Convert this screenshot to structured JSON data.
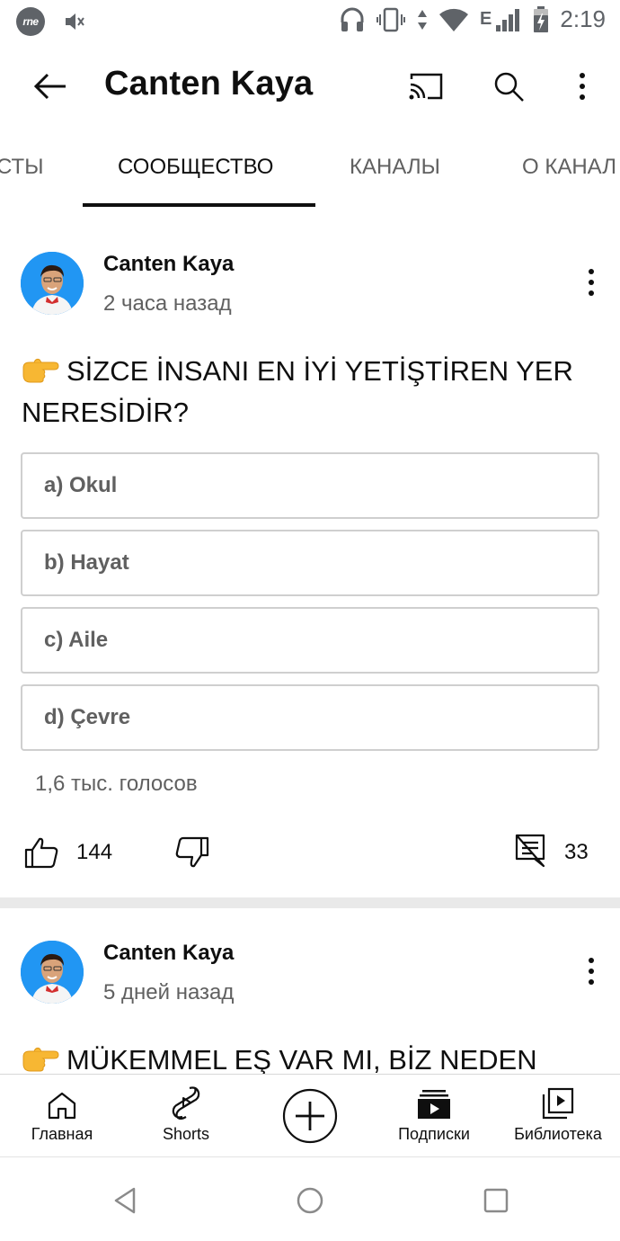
{
  "status_bar": {
    "carrier_logo": "rne",
    "time": "2:19",
    "network": "E",
    "icons": [
      "headphones-icon",
      "vibrate-icon",
      "wifi-icon",
      "signal-icon",
      "battery-icon",
      "mute-icon"
    ]
  },
  "app_bar": {
    "title": "Canten Kaya",
    "icons": [
      "back-arrow-icon",
      "cast-icon",
      "search-icon",
      "more-vert-icon"
    ]
  },
  "tabs": [
    {
      "label": "СТЫ",
      "active": false
    },
    {
      "label": "СООБЩЕСТВО",
      "active": true
    },
    {
      "label": "КАНАЛЫ",
      "active": false
    },
    {
      "label": "О КАНАЛ",
      "active": false
    }
  ],
  "posts": [
    {
      "author": "Canten Kaya",
      "time": "2 часа назад",
      "emoji": "👉",
      "text": "SİZCE İNSANI EN İYİ YETİŞTİREN YER NERESİDİR?",
      "poll_options": [
        "a) Okul",
        "b) Hayat",
        "c) Aile",
        "d) Çevre"
      ],
      "votes": "1,6 тыс. голосов",
      "likes": "144",
      "comments": "33"
    },
    {
      "author": "Canten Kaya",
      "time": "5 дней назад",
      "emoji": "👉",
      "text": "MÜKEMMEL EŞ VAR MI, BİZ NEDEN"
    }
  ],
  "bottom_nav": [
    {
      "label": "Главная",
      "icon": "home-icon"
    },
    {
      "label": "Shorts",
      "icon": "shorts-icon"
    },
    {
      "label": "",
      "icon": "create-icon"
    },
    {
      "label": "Подписки",
      "icon": "subscriptions-icon"
    },
    {
      "label": "Библиотека",
      "icon": "library-icon"
    }
  ],
  "system_nav": [
    "back-triangle-icon",
    "home-circle-icon",
    "recents-square-icon"
  ],
  "colors": {
    "text_primary": "#0f0f0f",
    "text_secondary": "#606060",
    "border": "#cfcfcf",
    "divider": "#e9e9e9"
  }
}
